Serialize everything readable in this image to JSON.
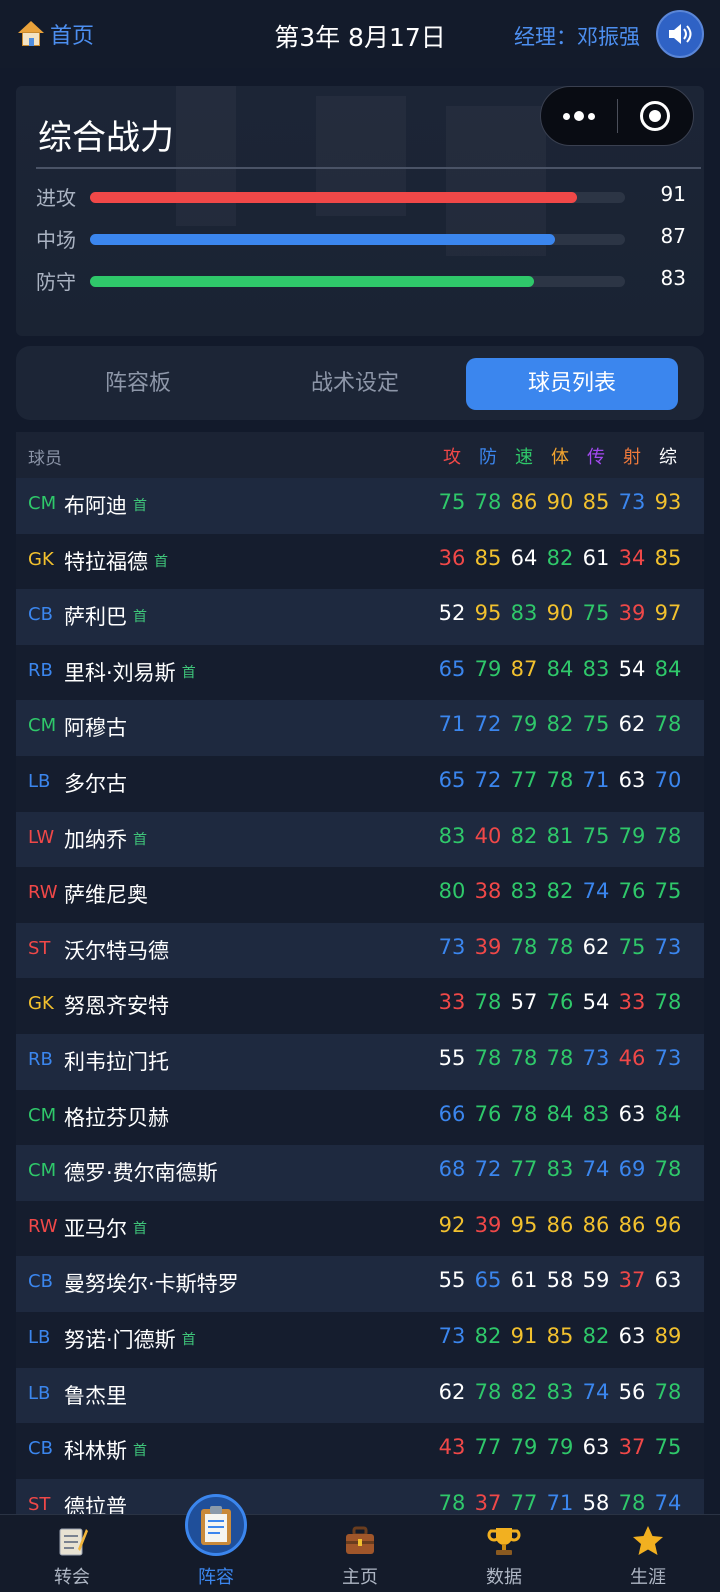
{
  "header": {
    "home_label": "首页",
    "date": "第3年 8月17日",
    "manager": "经理：邓振强"
  },
  "power": {
    "title": "综合战力",
    "stats": [
      {
        "label": "进攻",
        "value": 91,
        "color": "#f04848"
      },
      {
        "label": "中场",
        "value": 87,
        "color": "#3b86ee"
      },
      {
        "label": "防守",
        "value": 83,
        "color": "#2fc86a"
      }
    ]
  },
  "tabs": [
    {
      "label": "阵容板",
      "active": false
    },
    {
      "label": "战术设定",
      "active": false
    },
    {
      "label": "球员列表",
      "active": true
    }
  ],
  "table": {
    "player_header": "球员",
    "columns": [
      {
        "label": "攻",
        "color": "#f04848"
      },
      {
        "label": "防",
        "color": "#3b86ee"
      },
      {
        "label": "速",
        "color": "#2fc86a"
      },
      {
        "label": "体",
        "color": "#f2a32e"
      },
      {
        "label": "传",
        "color": "#a349f0"
      },
      {
        "label": "射",
        "color": "#f07a3b"
      },
      {
        "label": "综",
        "color": "#ffffff"
      }
    ],
    "starter_label": "首",
    "rows": [
      {
        "pos": "CM",
        "name": "布阿迪",
        "starter": true,
        "stats": [
          75,
          78,
          86,
          90,
          85,
          73,
          93
        ]
      },
      {
        "pos": "GK",
        "name": "特拉福德",
        "starter": true,
        "stats": [
          36,
          85,
          64,
          82,
          61,
          34,
          85
        ]
      },
      {
        "pos": "CB",
        "name": "萨利巴",
        "starter": true,
        "stats": [
          52,
          95,
          83,
          90,
          75,
          39,
          97
        ]
      },
      {
        "pos": "RB",
        "name": "里科·刘易斯",
        "starter": true,
        "stats": [
          65,
          79,
          87,
          84,
          83,
          54,
          84
        ]
      },
      {
        "pos": "CM",
        "name": "阿穆古",
        "starter": false,
        "stats": [
          71,
          72,
          79,
          82,
          75,
          62,
          78
        ]
      },
      {
        "pos": "LB",
        "name": "多尔古",
        "starter": false,
        "stats": [
          65,
          72,
          77,
          78,
          71,
          63,
          70
        ]
      },
      {
        "pos": "LW",
        "name": "加纳乔",
        "starter": true,
        "stats": [
          83,
          40,
          82,
          81,
          75,
          79,
          78
        ]
      },
      {
        "pos": "RW",
        "name": "萨维尼奥",
        "starter": false,
        "stats": [
          80,
          38,
          83,
          82,
          74,
          76,
          75
        ]
      },
      {
        "pos": "ST",
        "name": "沃尔特马德",
        "starter": false,
        "stats": [
          73,
          39,
          78,
          78,
          62,
          75,
          73
        ]
      },
      {
        "pos": "GK",
        "name": "努恩齐安特",
        "starter": false,
        "stats": [
          33,
          78,
          57,
          76,
          54,
          33,
          78
        ]
      },
      {
        "pos": "RB",
        "name": "利韦拉门托",
        "starter": false,
        "stats": [
          55,
          78,
          78,
          78,
          73,
          46,
          73
        ]
      },
      {
        "pos": "CM",
        "name": "格拉芬贝赫",
        "starter": false,
        "stats": [
          66,
          76,
          78,
          84,
          83,
          63,
          84
        ]
      },
      {
        "pos": "CM",
        "name": "德罗·费尔南德斯",
        "starter": false,
        "stats": [
          68,
          72,
          77,
          83,
          74,
          69,
          78
        ]
      },
      {
        "pos": "RW",
        "name": "亚马尔",
        "starter": true,
        "stats": [
          92,
          39,
          95,
          86,
          86,
          86,
          96
        ]
      },
      {
        "pos": "CB",
        "name": "曼努埃尔·卡斯特罗",
        "starter": false,
        "stats": [
          55,
          65,
          61,
          58,
          59,
          37,
          63
        ]
      },
      {
        "pos": "LB",
        "name": "努诺·门德斯",
        "starter": true,
        "stats": [
          73,
          82,
          91,
          85,
          82,
          63,
          89
        ]
      },
      {
        "pos": "LB",
        "name": "鲁杰里",
        "starter": false,
        "stats": [
          62,
          78,
          82,
          83,
          74,
          56,
          78
        ]
      },
      {
        "pos": "CB",
        "name": "科林斯",
        "starter": true,
        "stats": [
          43,
          77,
          79,
          79,
          63,
          37,
          75
        ]
      },
      {
        "pos": "ST",
        "name": "德拉普",
        "starter": false,
        "stats": [
          78,
          37,
          77,
          71,
          58,
          78,
          74
        ]
      }
    ]
  },
  "pos_colors": {
    "CM": "#2fc86a",
    "GK": "#f2c12e",
    "CB": "#3b86ee",
    "RB": "#3b86ee",
    "LB": "#3b86ee",
    "LW": "#f04848",
    "RW": "#f04848",
    "ST": "#f04848"
  },
  "value_colors": {
    "gold": "#f2c12e",
    "green": "#2fc86a",
    "blue": "#3b86ee",
    "white": "#ffffff",
    "red": "#f04848"
  },
  "bottom_nav": [
    {
      "label": "转会",
      "icon": "notepad-icon",
      "active": false
    },
    {
      "label": "阵容",
      "icon": "clipboard-icon",
      "active": true
    },
    {
      "label": "主页",
      "icon": "briefcase-icon",
      "active": false
    },
    {
      "label": "数据",
      "icon": "trophy-icon",
      "active": false
    },
    {
      "label": "生涯",
      "icon": "star-icon",
      "active": false
    }
  ]
}
